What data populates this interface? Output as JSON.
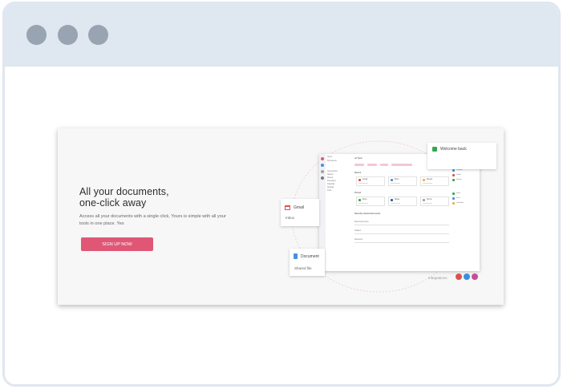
{
  "browser": {
    "window_controls": [
      "close-dot",
      "minimize-dot",
      "maximize-dot"
    ]
  },
  "hero": {
    "headline_line1": "All your documents,",
    "headline_line2": "one-click away",
    "subtext": "Access all your documents with a single click, Yours is simple with all your tools in one place. Yes",
    "cta_label": "SIGN UP NOW"
  },
  "mock_app": {
    "title": "All Tools",
    "nav_items": [
      "Home",
      "Documents",
      "Connections",
      "Shared",
      "Recent",
      "Favourites",
      "Calendar",
      "Settings",
      "Tools"
    ],
    "sections": [
      "Recent",
      "Pinned",
      "Recently shared documents"
    ],
    "tiles_row1": [
      "Gmail",
      "Docs",
      "Sheets"
    ],
    "tiles_row2": [
      "Drive",
      "Slides",
      "Forms"
    ],
    "fields": [
      "Document name",
      "Subject",
      "Received"
    ],
    "side_items": [
      "Outlook",
      "Gmail",
      "Sheets",
      "Drive",
      "Docs",
      "Calendar"
    ]
  },
  "floats": {
    "top_card_title": "Welcome back",
    "gmail_card_title": "Gmail",
    "gmail_card_sub": "Inbox",
    "docs_card_title": "Document",
    "docs_card_sub": "Shared file"
  },
  "footer": {
    "credit": "Integrations"
  },
  "colors": {
    "titlebar": "#dfe7f0",
    "dots": "#98a4b2",
    "accent": "#e05776",
    "card": "#f7f7f7"
  }
}
